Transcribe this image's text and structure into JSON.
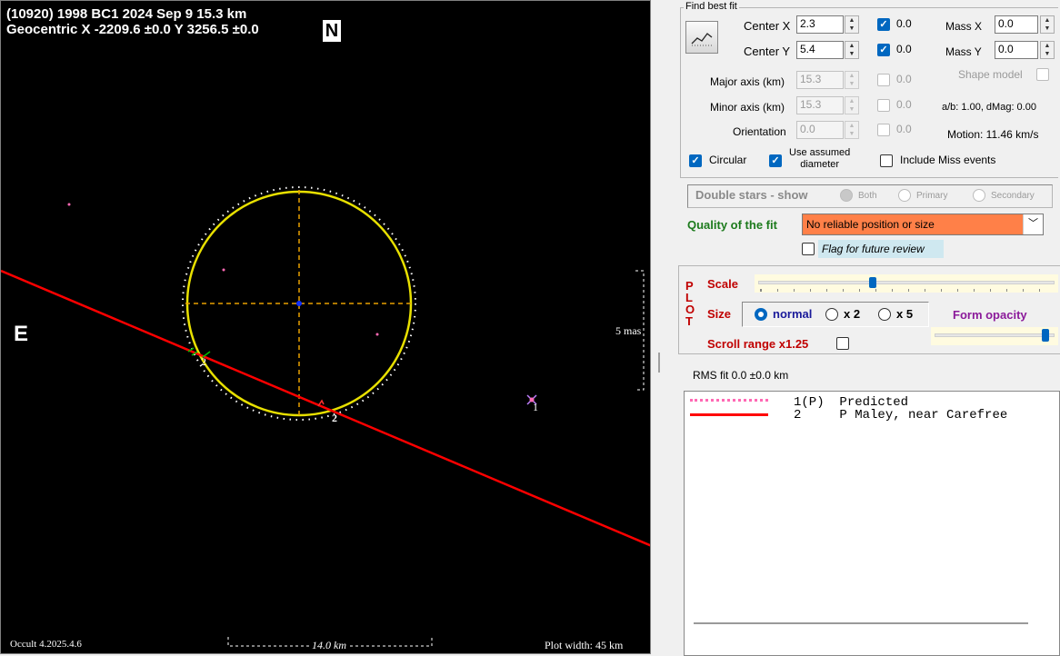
{
  "plot": {
    "header_line1": "(10920) 1998 BC1  2024 Sep 9   15.3 km",
    "header_line2": "Geocentric  X  -2209.6 ±0.0  Y 3256.5 ±0.0",
    "north_label": "N",
    "east_label": "E",
    "scale_mas_label": "5 mas",
    "scale_km_label": "14.0 km",
    "version_label": "Occult 4.2025.4.6",
    "plot_width_label": "Plot width: 45 km",
    "chord_label_2a": "2",
    "chord_label_2b": "2",
    "star_label_1": "1",
    "colors": {
      "ellipse": "#e8e000",
      "chord": "#ff0000",
      "axes": "#e8a000",
      "predicted_dots": "#ff69b4"
    }
  },
  "panel": {
    "find_best_fit_title": "Find best fit",
    "fit_button_icon": "fit-chart-icon",
    "center_x_label": "Center X",
    "center_x_value": "2.3",
    "center_x_step": "0.0",
    "center_y_label": "Center Y",
    "center_y_value": "5.4",
    "center_y_step": "0.0",
    "mass_x_label": "Mass X",
    "mass_x_value": "0.0",
    "mass_y_label": "Mass Y",
    "mass_y_value": "0.0",
    "shape_model_label": "Shape model",
    "major_axis_label": "Major axis (km)",
    "major_axis_value": "15.3",
    "major_axis_step": "0.0",
    "minor_axis_label": "Minor axis (km)",
    "minor_axis_value": "15.3",
    "minor_axis_step": "0.0",
    "ab_dmag": "a/b: 1.00, dMag: 0.00",
    "orientation_label": "Orientation",
    "orientation_value": "0.0",
    "orientation_step": "0.0",
    "motion": "Motion: 11.46 km/s",
    "circular_label": "Circular",
    "use_assumed_label_1": "Use assumed",
    "use_assumed_label_2": "diameter",
    "include_miss_label": "Include Miss events",
    "double_stars_title": "Double stars - show",
    "ds_both": "Both",
    "ds_primary": "Primary",
    "ds_secondary": "Secondary",
    "quality_label": "Quality of the fit",
    "quality_value": "No reliable position or size",
    "flag_review_label": "Flag for future review",
    "plot_vertical_label": "PLOT",
    "scale_label": "Scale",
    "size_label": "Size",
    "size_normal": "normal",
    "size_x2": "x 2",
    "size_x5": "x 5",
    "form_opacity_label": "Form opacity",
    "scroll_range_label": "Scroll range x1.25",
    "rms_fit": "RMS fit 0.0 ±0.0 km",
    "legend": [
      {
        "index": "1(P)",
        "text": "Predicted"
      },
      {
        "index": "2",
        "text": "P Maley, near Carefree"
      }
    ]
  }
}
